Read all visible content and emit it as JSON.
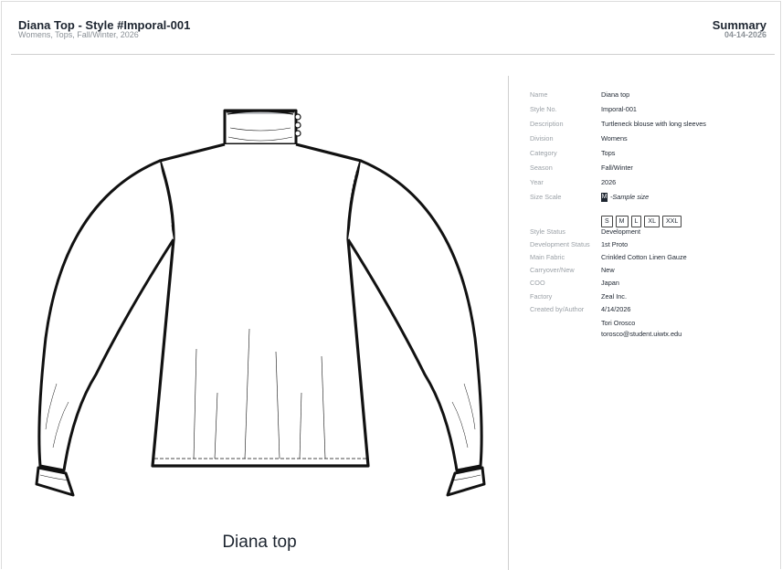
{
  "header": {
    "title": "Diana Top - Style #Imporal-001",
    "subtitle": "Womens, Tops, Fall/Winter, 2026",
    "summary": "Summary",
    "date": "04-14-2026"
  },
  "sketch": {
    "caption": "Diana top"
  },
  "specs": {
    "name_label": "Name",
    "name": "Diana top",
    "style_no_label": "Style No.",
    "style_no": "Imporal-001",
    "description_label": "Description",
    "description": "Turtleneck blouse with long sleeves",
    "division_label": "Division",
    "division": "Womens",
    "category_label": "Category",
    "category": "Tops",
    "season_label": "Season",
    "season": "Fall/Winter",
    "year_label": "Year",
    "year": "2026",
    "size_scale_label": "Size Scale",
    "sample_size": "M",
    "sample_size_note": "-Sample size",
    "sizes": [
      "S",
      "M",
      "L",
      "XL",
      "XXL"
    ],
    "style_status_label": "Style Status",
    "style_status": "Development",
    "development_status_label": "Development Status",
    "development_status": "1st Proto",
    "main_fabric_label": "Main Fabric",
    "main_fabric": "Crinkled Cotton Linen Gauze",
    "carryover_label": "Carryover/New",
    "carryover": "New",
    "coo_label": "COO",
    "coo": "Japan",
    "factory_label": "Factory",
    "factory": "Zeal Inc.",
    "created_label": "Created by/Author",
    "created_date": "4/14/2026",
    "author_name": "Tori Orosco",
    "author_email": "torosco@student.uiwtx.edu"
  }
}
